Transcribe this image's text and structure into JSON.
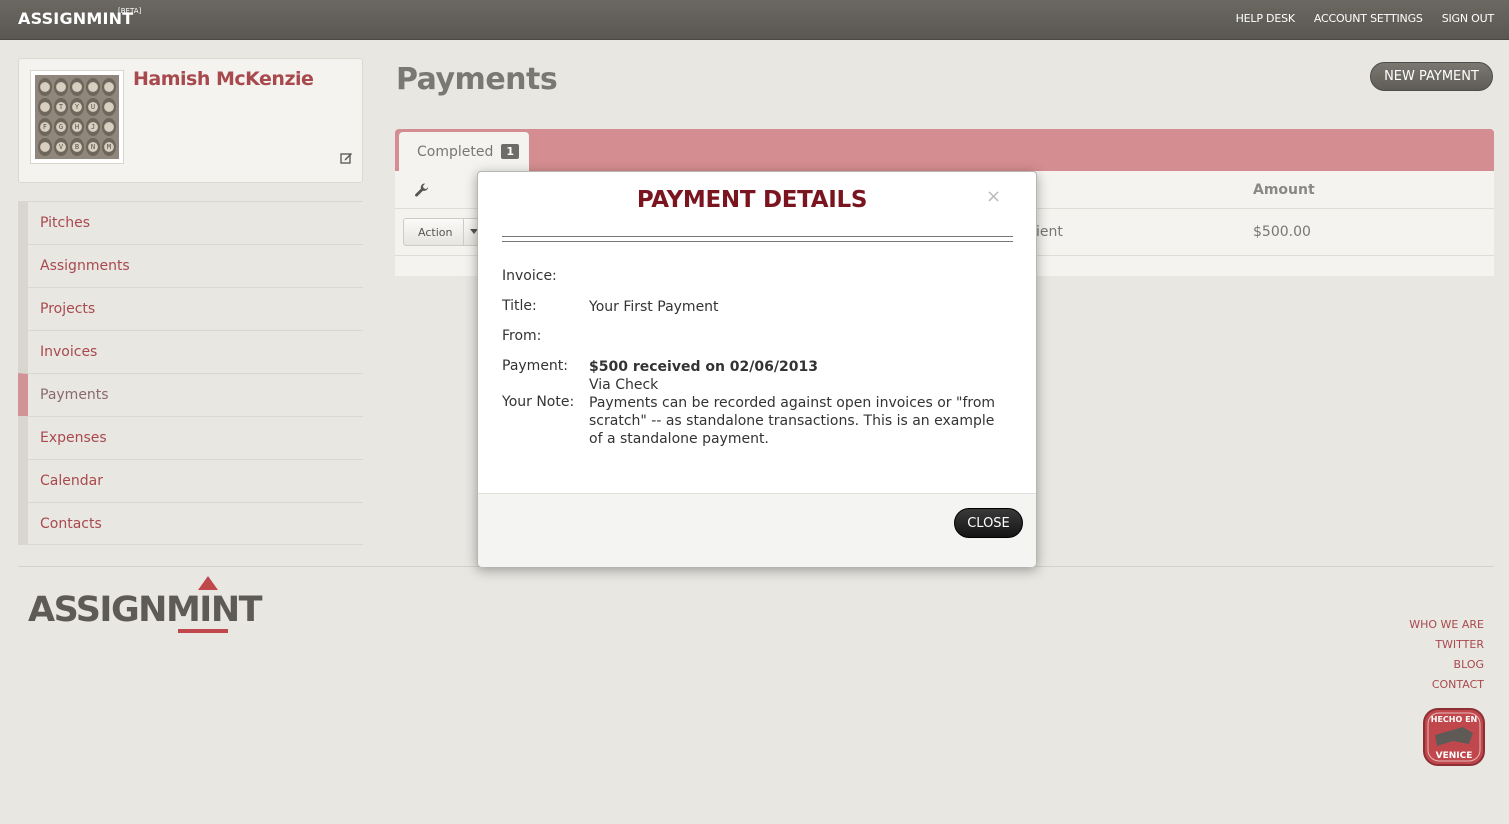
{
  "topbar": {
    "brand": "ASSIGNMINT",
    "beta": "[BETA]",
    "links": [
      "HELP DESK",
      "ACCOUNT SETTINGS",
      "SIGN OUT"
    ]
  },
  "profile": {
    "name": "Hamish McKenzie",
    "avatar_keys": [
      "",
      "",
      "",
      "",
      "",
      "",
      "T",
      "Y",
      "U",
      "",
      "F",
      "G",
      "H",
      "J",
      "",
      "",
      "V",
      "B",
      "N",
      "M"
    ]
  },
  "sidebar": {
    "items": [
      {
        "label": "Pitches"
      },
      {
        "label": "Assignments"
      },
      {
        "label": "Projects"
      },
      {
        "label": "Invoices"
      },
      {
        "label": "Payments",
        "active": true
      },
      {
        "label": "Expenses"
      },
      {
        "label": "Calendar"
      },
      {
        "label": "Contacts"
      }
    ]
  },
  "main": {
    "title": "Payments",
    "new_payment_label": "NEW PAYMENT",
    "tab": {
      "label": "Completed",
      "count": "1"
    },
    "table": {
      "header_amount": "Amount",
      "row": {
        "action_label": "Action",
        "client_partial": "ient",
        "amount": "$500.00"
      }
    }
  },
  "modal": {
    "title": "PAYMENT DETAILS",
    "close_x": "×",
    "labels": {
      "invoice": "Invoice:",
      "title": "Title:",
      "from": "From:",
      "payment": "Payment:",
      "note": "Your Note:"
    },
    "values": {
      "title": "Your First Payment",
      "payment": "$500 received on 02/06/2013",
      "via": "Via Check",
      "note": "Payments can be recorded against open invoices or \"from scratch\" -- as standalone transactions. This is an example of a standalone payment."
    },
    "close_label": "CLOSE"
  },
  "footer": {
    "logo": "ASSIGNMINT",
    "links": [
      "WHO WE ARE",
      "TWITTER",
      "BLOG",
      "CONTACT"
    ],
    "badge_top": "HECHO EN",
    "badge_bottom": "VENICE"
  },
  "colors": {
    "accent": "#a8494e",
    "tab_bar": "#d48d90",
    "modal_title": "#7a1520",
    "topbar": "#5f5c57"
  }
}
